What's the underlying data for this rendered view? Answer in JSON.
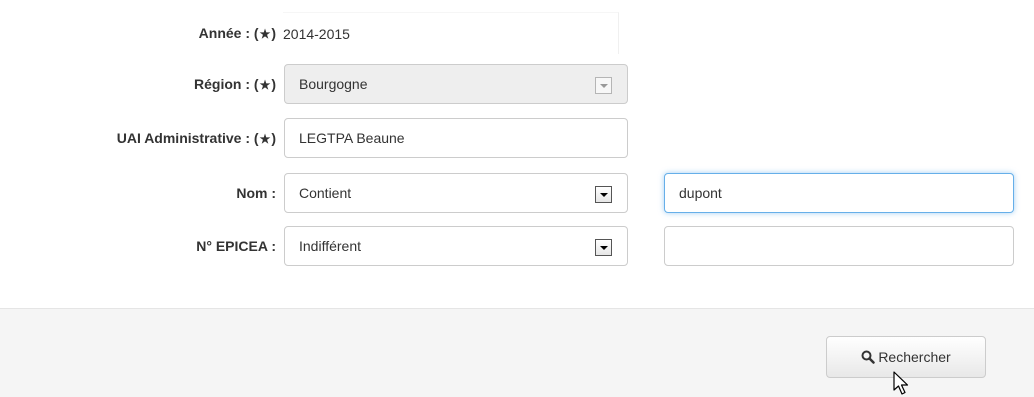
{
  "form": {
    "annee": {
      "label": "Année : (",
      "star": "★",
      "suffix": ")",
      "value": "2014-2015"
    },
    "region": {
      "label": "Région : (",
      "star": "★",
      "suffix": ")",
      "value": "Bourgogne"
    },
    "uai": {
      "label": "UAI Administrative : (",
      "star": "★",
      "suffix": ")",
      "value": "LEGTPA Beaune"
    },
    "nom": {
      "label": "Nom :",
      "operator": "Contient",
      "value": "dupont"
    },
    "epicea": {
      "label": "N° EPICEA :",
      "operator": "Indifférent",
      "value": ""
    }
  },
  "footer": {
    "search_label": "Rechercher"
  },
  "colors": {
    "focus_border": "#66afe9",
    "footer_bg": "#f5f5f5",
    "disabled_bg": "#eeeeee"
  },
  "icons": {
    "search": "search-icon",
    "dropdown": "dropdown-arrow-icon",
    "cursor": "mouse-pointer-icon"
  }
}
